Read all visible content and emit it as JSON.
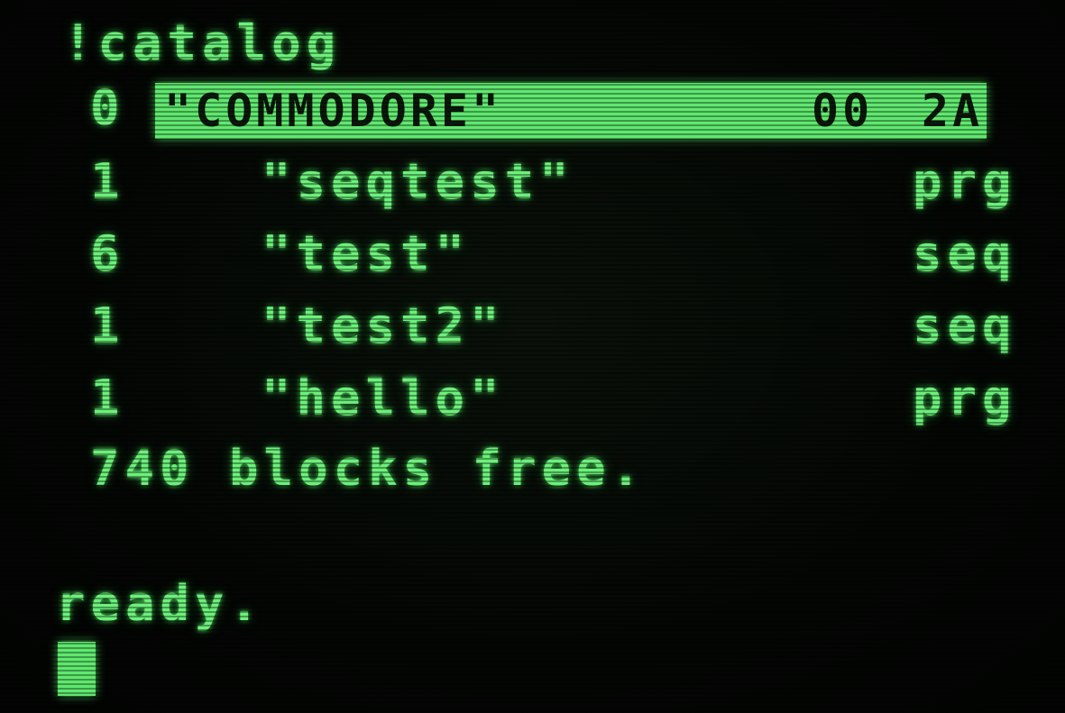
{
  "command": "!catalog",
  "header": {
    "drive": "0",
    "disk_name": "\"COMMODORE\"",
    "disk_id": "00",
    "dos_format": "2A"
  },
  "files": [
    {
      "blocks": "1",
      "name": "\"seqtest\"",
      "type": "prg"
    },
    {
      "blocks": "6",
      "name": "\"test\"",
      "type": "seq"
    },
    {
      "blocks": "1",
      "name": "\"test2\"",
      "type": "seq"
    },
    {
      "blocks": "1",
      "name": "\"hello\"",
      "type": "prg"
    }
  ],
  "blocks_free": "740 blocks free.",
  "prompt": "ready.",
  "colors": {
    "phosphor": "#6cf07a",
    "background": "#030503"
  }
}
